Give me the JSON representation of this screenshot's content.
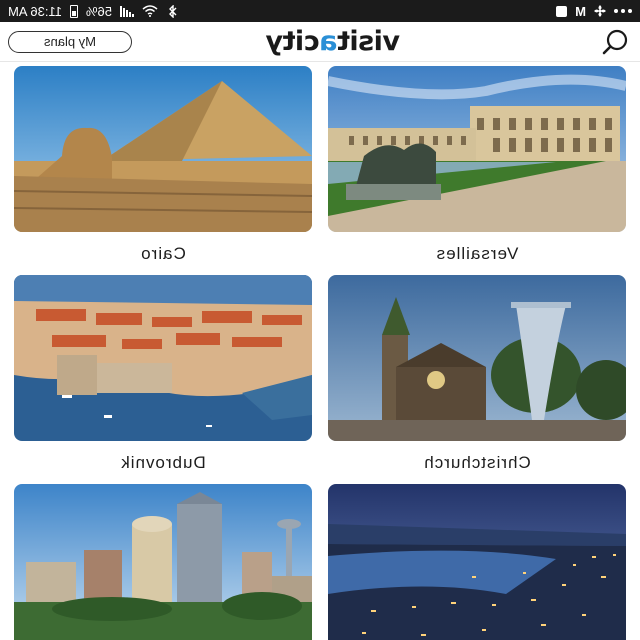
{
  "status_bar": {
    "time": "11:36 AM",
    "battery": "56%",
    "network": "M"
  },
  "header": {
    "logo_prefix": "visit",
    "logo_accent": "a",
    "logo_suffix": "city",
    "plans_label": "My plans"
  },
  "cities": [
    {
      "name": "Versailles"
    },
    {
      "name": "Cairo"
    },
    {
      "name": "Christchurch"
    },
    {
      "name": "Dubrovnik"
    },
    {
      "name": ""
    },
    {
      "name": ""
    }
  ],
  "colors": {
    "accent": "#2a8fd6",
    "status_bar": "#1b1b1b",
    "text": "#1d1d1d"
  },
  "icons": [
    "search-icon",
    "wifi-icon",
    "signal-icon",
    "battery-icon",
    "bluetooth-icon",
    "more-icon"
  ]
}
